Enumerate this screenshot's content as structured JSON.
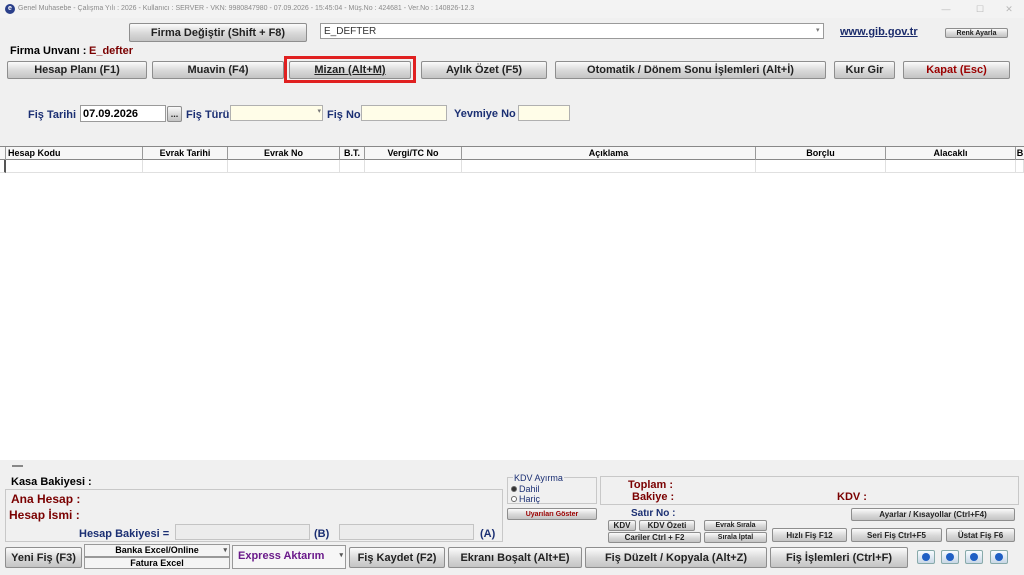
{
  "window": {
    "title": "Genel Muhasebe  -  Çalışma Yılı : 2026  -  Kullanıcı : SERVER  -  VKN: 9980847980  -  07.09.2026 - 15:45:04  -  Müş.No : 424681  -  Ver.No : 140826-12.3",
    "minimize": "—",
    "maximize": "☐",
    "close": "✕"
  },
  "top": {
    "firma_degistir": "Firma Değiştir (Shift + F8)",
    "firma_select_value": "E_DEFTER",
    "gib_link": "www.gib.gov.tr",
    "renk_ayarla": "Renk Ayarla",
    "firma_unvani_label": "Firma Unvanı :",
    "firma_unvani_value": "E_defter"
  },
  "toolbar": {
    "hesap_plani": "Hesap Planı (F1)",
    "muavin": "Muavin (F4)",
    "mizan": "Mizan (Alt+M)",
    "aylik_ozet": "Aylık Özet (F5)",
    "otomatik": "Otomatik / Dönem Sonu İşlemleri (Alt+İ)",
    "kur_gir": "Kur Gir",
    "kapat": "Kapat (Esc)"
  },
  "fis": {
    "tarih_label": "Fiş Tarihi",
    "tarih_value": "07.09.2026",
    "date_picker": "...",
    "turu_label": "Fiş Türü",
    "no_label": "Fiş No",
    "yevmiye_label": "Yevmiye No"
  },
  "grid": {
    "columns": [
      "Hesap Kodu",
      "Evrak Tarihi",
      "Evrak No",
      "B.T.",
      "Vergi/TC No",
      "Açıklama",
      "Borçlu",
      "Alacaklı",
      "B"
    ]
  },
  "bottom": {
    "kasa_bakiyesi": "Kasa Bakiyesi :",
    "ana_hesap": "Ana Hesap :",
    "hesap_ismi": "Hesap İsmi :",
    "hesap_bakiyesi": "Hesap Bakiyesi =",
    "b_label": "(B)",
    "a_label": "(A)",
    "kdv_ayirma": "KDV Ayırma",
    "dahil": "Dahil",
    "haric": "Hariç",
    "uyarilari_goster": "Uyarıları Göster",
    "toplam": "Toplam :",
    "bakiye": "Bakiye :",
    "kdv_label": "KDV :",
    "satir_no": "Satır No :",
    "kdv_btn": "KDV",
    "kdv_ozeti": "KDV Özeti",
    "evrak_sirala": "Evrak Sırala",
    "cariler": "Cariler Ctrl + F2",
    "sirala_iptal": "Sırala İptal",
    "ayarlar": "Ayarlar / Kısayollar (Ctrl+F4)",
    "hizli_fis": "Hızlı Fiş F12",
    "seri_fis": "Seri Fiş Ctrl+F5",
    "ustat_fis": "Üstat Fiş F6"
  },
  "actions": {
    "yeni_fis": "Yeni Fiş (F3)",
    "banka_excel": "Banka Excel/Online",
    "fatura_excel": "Fatura Excel",
    "express": "Express Aktarım",
    "fis_kaydet": "Fiş Kaydet (F2)",
    "ekrani_bosalt": "Ekranı Boşalt (Alt+E)",
    "fis_duzelt": "Fiş Düzelt / Kopyala (Alt+Z)",
    "fis_islemleri": "Fiş İşlemleri (Ctrl+F)"
  },
  "colors": {
    "highlight_red": "#e02020",
    "maroon": "#7a0000",
    "navy": "#1b2f73",
    "express_purple": "#6a1a8a",
    "link_navy": "#1a2b6b"
  }
}
